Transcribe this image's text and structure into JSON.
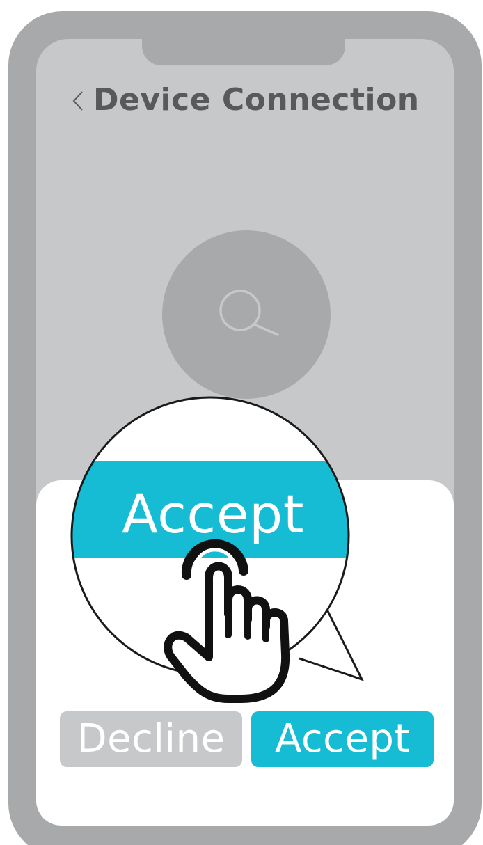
{
  "header": {
    "back_icon": "chevron-left-icon",
    "title": "Device Connection"
  },
  "search": {
    "icon": "search-icon"
  },
  "dialog": {
    "decline_label": "Decline",
    "accept_label": "Accept"
  },
  "callout": {
    "accept_label": "Accept",
    "pointer_icon": "hand-pointer-icon"
  },
  "colors": {
    "accent": "#15bcd4",
    "frame": "#a8a9aa",
    "screen": "#c7c8ca",
    "title_text": "#58595b",
    "button_text": "#ffffff"
  }
}
